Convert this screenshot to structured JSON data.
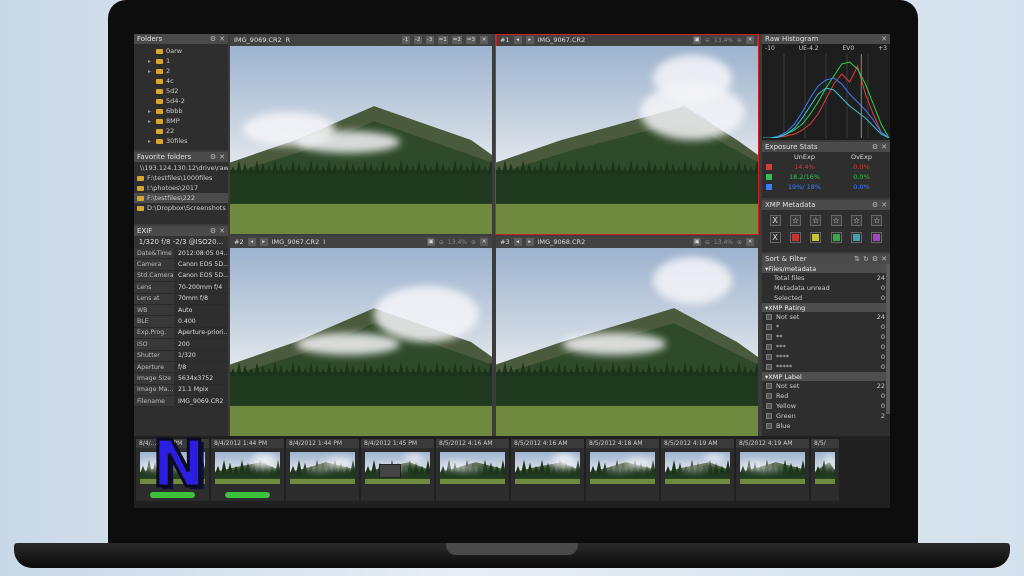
{
  "folders": {
    "title": "Folders",
    "items": [
      {
        "label": "0arw",
        "expand": ""
      },
      {
        "label": "1",
        "expand": "▸"
      },
      {
        "label": "2",
        "expand": "▸"
      },
      {
        "label": "4c",
        "expand": ""
      },
      {
        "label": "5d2",
        "expand": ""
      },
      {
        "label": "5d4-2",
        "expand": ""
      },
      {
        "label": "6bbb",
        "expand": "▸"
      },
      {
        "label": "8MP",
        "expand": "▸"
      },
      {
        "label": "22",
        "expand": ""
      },
      {
        "label": "30files",
        "expand": "▸"
      }
    ]
  },
  "favorites": {
    "title": "Favorite folders",
    "items": [
      "\\\\193.124.130.12\\drive\\raw",
      "F:\\testfiles\\1000files",
      "I:\\photoes\\2017",
      "F:\\testfiles\\222",
      "D:\\Dropbox\\Screenshots"
    ]
  },
  "exif": {
    "title": "EXIF",
    "summary": "1/320 f/8 -2/3 @ISO20...",
    "rows": [
      {
        "k": "Date&Time",
        "v": "2012:08:05 04..."
      },
      {
        "k": "Camera",
        "v": "Canon EOS 5D..."
      },
      {
        "k": "Std.Camera",
        "v": "Canon EOS 5D..."
      },
      {
        "k": "Lens",
        "v": "70-200mm f/4"
      },
      {
        "k": "Lens at",
        "v": "70mm f/8"
      },
      {
        "k": "WB",
        "v": "Auto"
      },
      {
        "k": "BLE",
        "v": "0.400"
      },
      {
        "k": "Exp.Prog.",
        "v": "Aperture-priori..."
      },
      {
        "k": "ISO",
        "v": "200"
      },
      {
        "k": "Shutter",
        "v": "1/320"
      },
      {
        "k": "Aperture",
        "v": "f/8"
      },
      {
        "k": "Image Size",
        "v": "5634x3752"
      },
      {
        "k": "Image Ma...",
        "v": "21.1 Mpix"
      },
      {
        "k": "Filename",
        "v": "IMG_9069.CR2"
      }
    ]
  },
  "viewers": [
    {
      "num": "",
      "file": "IMG_9069.CR2",
      "flag": "R",
      "zoom": "",
      "compare": [
        "-1",
        "-2",
        "-3",
        "=1",
        "=2",
        "=3"
      ],
      "active": false
    },
    {
      "num": "#1",
      "file": "IMG_9067.CR2",
      "flag": "",
      "zoom": "13.4%",
      "compare": [],
      "active": true
    },
    {
      "num": "#2",
      "file": "IMG_9067.CR2",
      "flag": "I",
      "zoom": "13.4%",
      "compare": [],
      "active": false
    },
    {
      "num": "#3",
      "file": "IMG_9068.CR2",
      "flag": "",
      "zoom": "13.4%",
      "compare": [],
      "active": false
    }
  ],
  "histogram": {
    "title": "Raw Histogram",
    "scale": [
      "-10",
      "UE-4.2",
      "EV0",
      "+3"
    ],
    "colors": {
      "red": "#e23b3b",
      "green": "#2fd34a",
      "blue": "#3b7bff",
      "cyan": "#37c6d8"
    }
  },
  "exposure": {
    "title": "Exposure Stats",
    "col1": "UnExp",
    "col2": "OvExp",
    "rows": [
      {
        "c1": "14.4%",
        "c2": "0.0%",
        "color": "#d33a3a"
      },
      {
        "c1": "18.2/16%",
        "c2": "0.0%",
        "color": "#2fbf55"
      },
      {
        "c1": "19%/ 18%",
        "c2": "0.0%",
        "color": "#3b7bff"
      }
    ]
  },
  "xmp_meta": {
    "title": "XMP Metadata",
    "stars": [
      "X",
      "☆",
      "☆",
      "☆",
      "☆",
      "☆"
    ],
    "labels": [
      {
        "color": "#3a3a3a",
        "text": "X"
      },
      {
        "color": "#c03434",
        "text": ""
      },
      {
        "color": "#c9c33a",
        "text": ""
      },
      {
        "color": "#3aa742",
        "text": ""
      },
      {
        "color": "#3aa0b3",
        "text": ""
      },
      {
        "color": "#a145c3",
        "text": ""
      }
    ]
  },
  "sort_filter": {
    "title": "Sort & Filter",
    "sections": [
      {
        "name": "Files/metadata",
        "rows": [
          {
            "label": "Total files",
            "num": "24",
            "check": false
          },
          {
            "label": "Metadata unread",
            "num": "0",
            "check": false
          },
          {
            "label": "Selected",
            "num": "0",
            "check": false
          }
        ]
      },
      {
        "name": "XMP Rating",
        "rows": [
          {
            "label": "Not set",
            "num": "24",
            "check": true
          },
          {
            "label": "*",
            "num": "0",
            "check": true
          },
          {
            "label": "**",
            "num": "0",
            "check": true
          },
          {
            "label": "***",
            "num": "0",
            "check": true
          },
          {
            "label": "****",
            "num": "0",
            "check": true
          },
          {
            "label": "*****",
            "num": "0",
            "check": true
          }
        ]
      },
      {
        "name": "XMP Label",
        "rows": [
          {
            "label": "Not set",
            "num": "22",
            "check": true
          },
          {
            "label": "Red",
            "num": "0",
            "check": true
          },
          {
            "label": "Yellow",
            "num": "0",
            "check": true
          },
          {
            "label": "Green",
            "num": "2",
            "check": true
          },
          {
            "label": "Blue",
            "num": "",
            "check": true
          }
        ]
      }
    ]
  },
  "filmstrip": [
    {
      "date": "8/4/... 1:44 PM",
      "badge": true,
      "scene": "mountain"
    },
    {
      "date": "8/4/2012 1:44 PM",
      "badge": true,
      "scene": "mountain"
    },
    {
      "date": "8/4/2012 1:44 PM",
      "badge": false,
      "scene": "meadow"
    },
    {
      "date": "8/4/2012 1:45 PM",
      "badge": false,
      "scene": "truck"
    },
    {
      "date": "8/5/2012 4:16 AM",
      "badge": false,
      "scene": "mountain"
    },
    {
      "date": "8/5/2012 4:16 AM",
      "badge": false,
      "scene": "mountain"
    },
    {
      "date": "8/5/2012 4:18 AM",
      "badge": false,
      "scene": "cloud"
    },
    {
      "date": "8/5/2012 4:19 AM",
      "badge": false,
      "scene": "mountain"
    },
    {
      "date": "8/5/2012 4:19 AM",
      "badge": false,
      "scene": "mountain"
    },
    {
      "date": "8/5/",
      "badge": false,
      "scene": "forest"
    }
  ],
  "logo": {
    "letter": "N"
  }
}
